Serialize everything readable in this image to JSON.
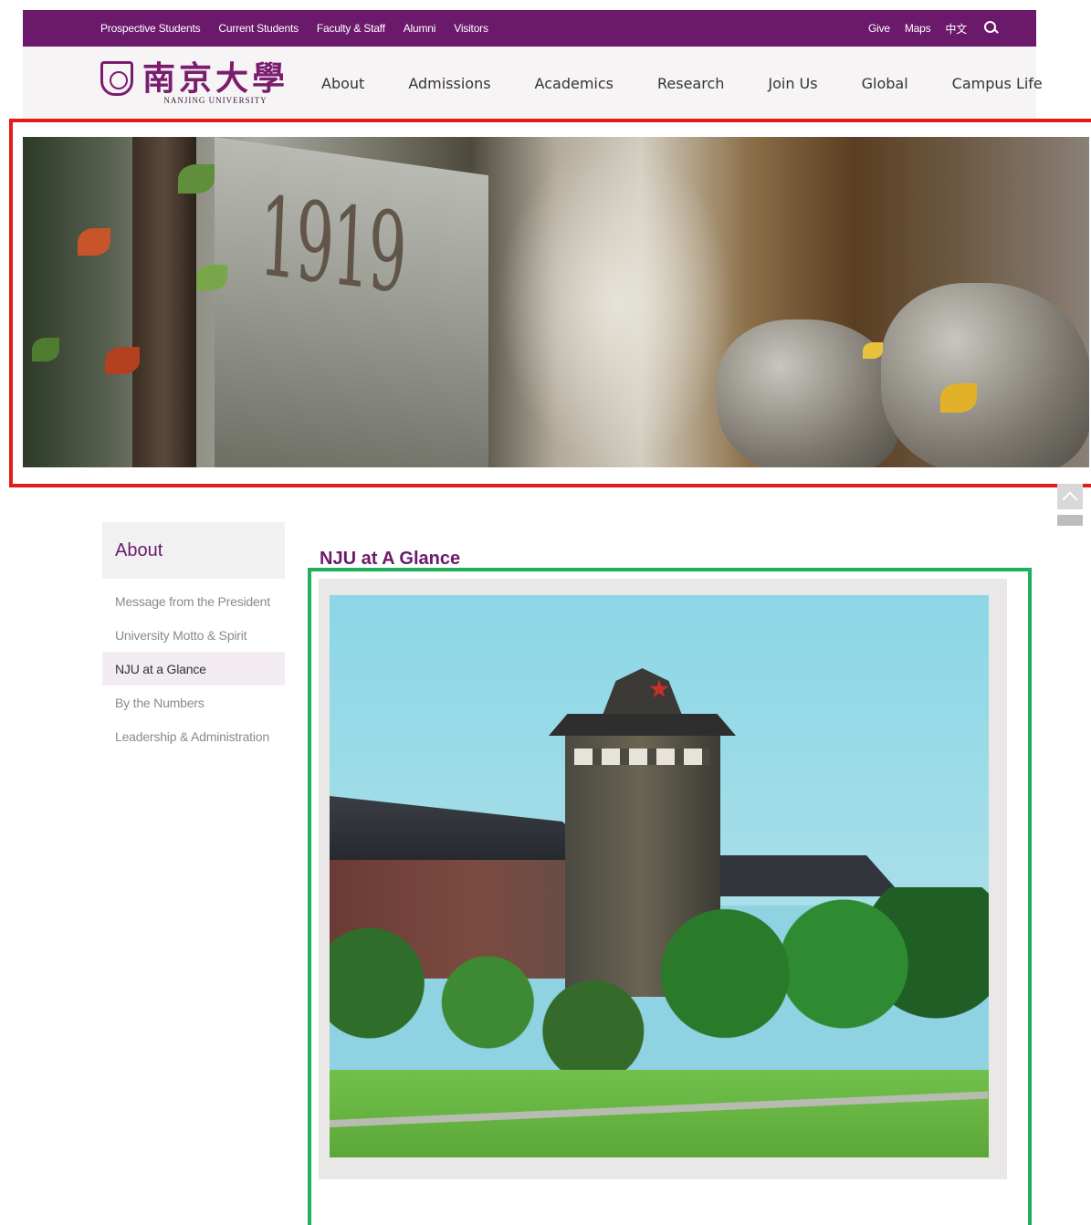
{
  "topbar": {
    "links": [
      "Prospective Students",
      "Current Students",
      "Faculty & Staff",
      "Alumni",
      "Visitors"
    ],
    "right_links": [
      "Give",
      "Maps",
      "中文"
    ],
    "search_icon": "search-icon",
    "color": "#6b1a6b"
  },
  "header": {
    "logo_cn": "南京大學",
    "logo_en": "NANJING UNIVERSITY",
    "nav": [
      "About",
      "Admissions",
      "Academics",
      "Research",
      "Join Us",
      "Global",
      "Campus Life"
    ]
  },
  "banner": {
    "year": "1919"
  },
  "sidebar": {
    "title": "About",
    "items": [
      {
        "label": "Message from the President",
        "active": false
      },
      {
        "label": "University Motto & Spirit",
        "active": false
      },
      {
        "label": "NJU at a Glance",
        "active": true
      },
      {
        "label": "By the Numbers",
        "active": false
      },
      {
        "label": "Leadership & Administration",
        "active": false
      }
    ]
  },
  "content": {
    "title": "NJU at A Glance"
  },
  "colors": {
    "accent": "#6b1a6b",
    "highlight_red": "#e41b1b",
    "highlight_green": "#1fb05b"
  }
}
